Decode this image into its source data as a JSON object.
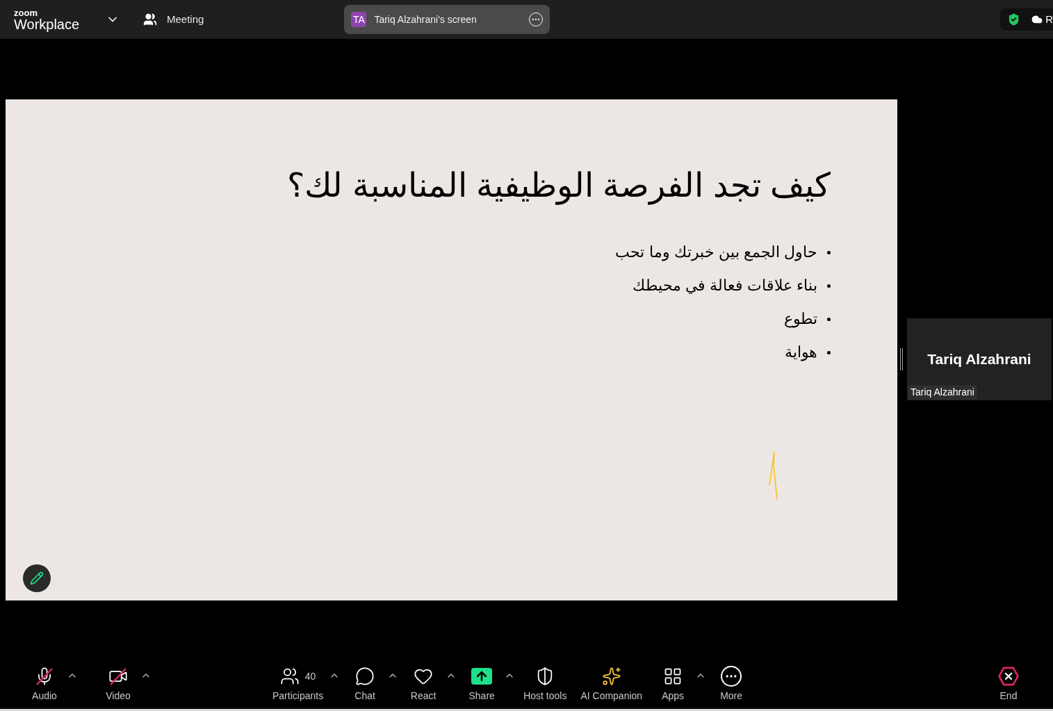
{
  "top_bar": {
    "brand_small": "zoom",
    "brand": "Workplace",
    "meeting_label": "Meeting",
    "share_pill": {
      "initials": "TA",
      "title": "Tariq Alzahrani's screen"
    },
    "status_text": "R"
  },
  "slide": {
    "title": "كيف تجد الفرصة الوظيفية المناسبة لك؟",
    "bullets": [
      "حاول الجمع بين خبرتك وما تحب",
      "بناء علاقات فعالة في محيطك",
      "تطوع",
      "هواية"
    ]
  },
  "video_tile": {
    "name": "Tariq Alzahrani",
    "name_tag": "Tariq Alzahrani"
  },
  "toolbar": [
    {
      "kind": "audio",
      "label": "Audio",
      "muted": true,
      "menu": true
    },
    {
      "kind": "video",
      "label": "Video",
      "muted": true,
      "menu": true
    },
    {
      "kind": "participants",
      "label": "Participants",
      "count": "40",
      "menu": true
    },
    {
      "kind": "chat",
      "label": "Chat",
      "menu": true
    },
    {
      "kind": "react",
      "label": "React",
      "menu": true
    },
    {
      "kind": "share",
      "label": "Share",
      "menu": true
    },
    {
      "kind": "host",
      "label": "Host tools",
      "menu": false
    },
    {
      "kind": "ai",
      "label": "AI Companion",
      "menu": false
    },
    {
      "kind": "apps",
      "label": "Apps",
      "menu": true
    },
    {
      "kind": "more",
      "label": "More",
      "menu": false
    },
    {
      "kind": "end",
      "label": "End",
      "menu": false
    }
  ]
}
